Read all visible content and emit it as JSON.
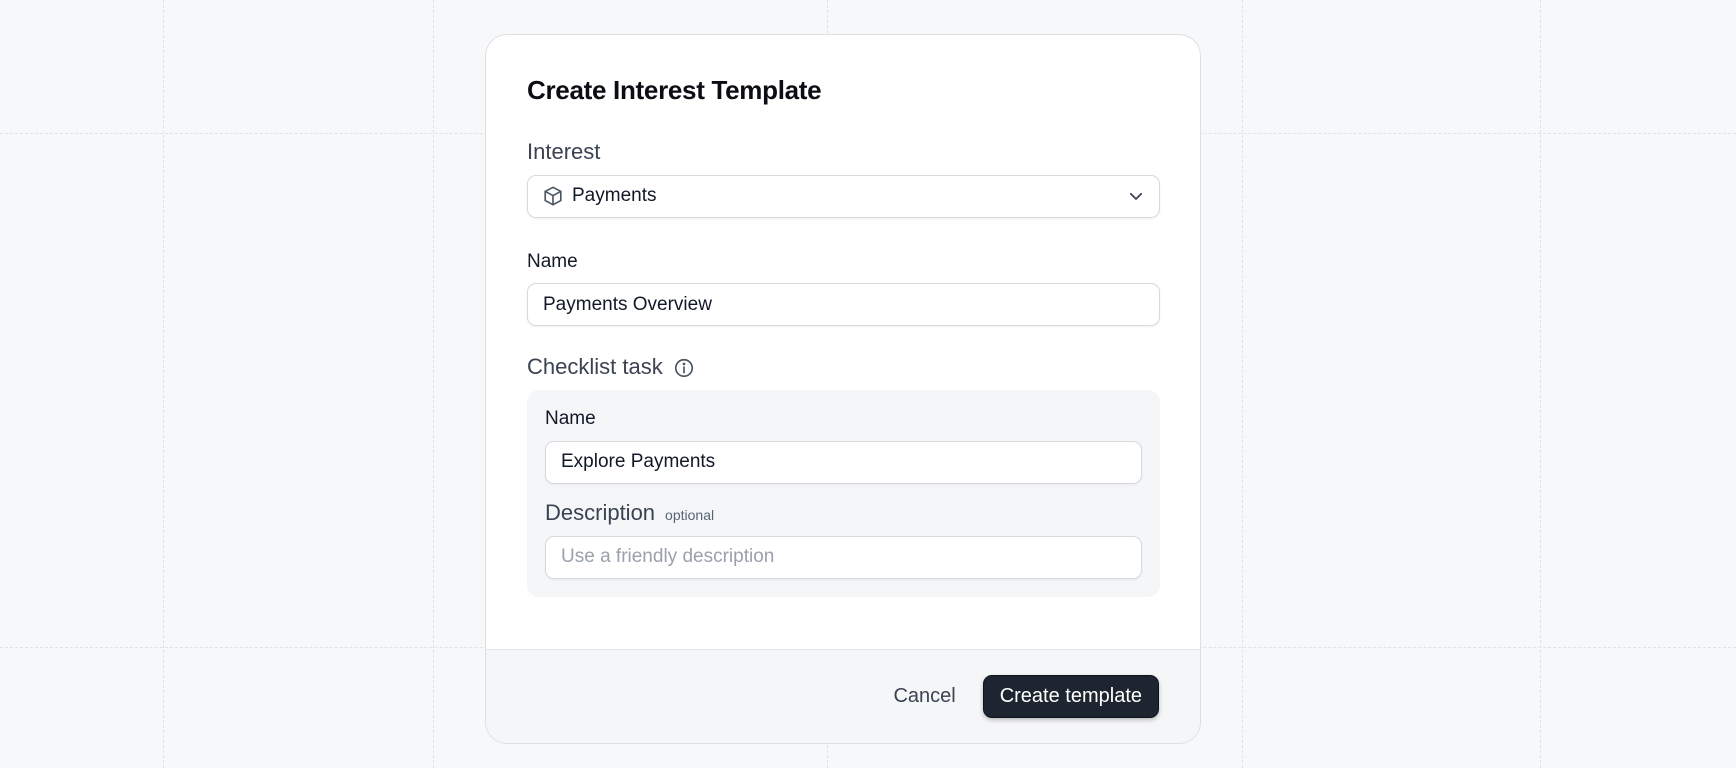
{
  "dialog": {
    "title": "Create Interest Template"
  },
  "interest": {
    "label": "Interest",
    "selected": "Payments",
    "icon": "cube-icon"
  },
  "name_field": {
    "label": "Name",
    "value": "Payments Overview"
  },
  "checklist": {
    "label": "Checklist task",
    "info_icon": "info-icon",
    "name": {
      "label": "Name",
      "value": "Explore Payments"
    },
    "description": {
      "label": "Description",
      "optional_tag": "optional",
      "placeholder": "Use a friendly description",
      "value": ""
    }
  },
  "footer": {
    "cancel_label": "Cancel",
    "submit_label": "Create template"
  }
}
